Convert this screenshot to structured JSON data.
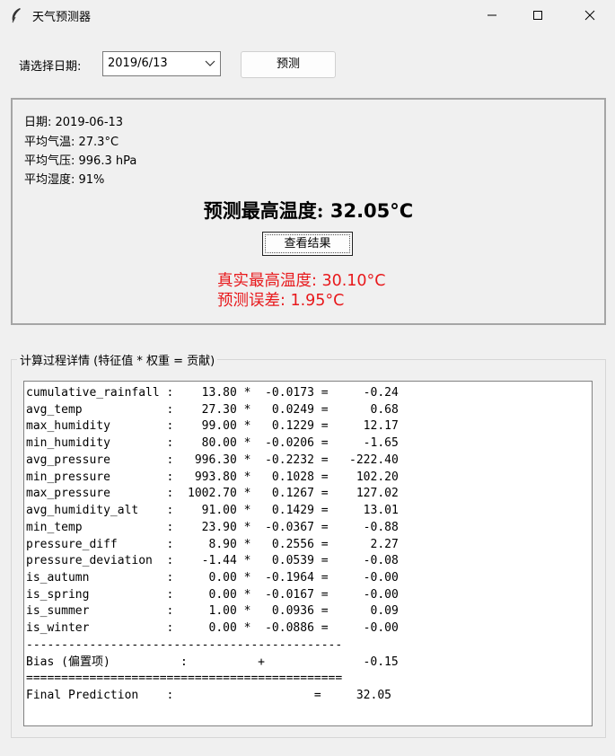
{
  "window": {
    "title": "天气预测器",
    "icon": "feather-icon",
    "controls": [
      "minimize-icon",
      "maximize-icon",
      "close-icon"
    ]
  },
  "toolbar": {
    "date_label": "请选择日期:",
    "date_value": "2019/6/13",
    "predict_label": "预测"
  },
  "info": {
    "date_line": "日期: 2019-06-13",
    "avg_temp_line": "平均气温: 27.3°C",
    "avg_pressure_line": "平均气压: 996.3 hPa",
    "avg_humidity_line": "平均湿度: 91%",
    "prediction_label": "预测最高温度: ",
    "prediction_value": "32.05°C",
    "view_result_label": "查看结果",
    "actual_max_line": "真实最高温度: 30.10°C",
    "error_line": "预测误差: 1.95°C",
    "highlight_color": "#e8191c"
  },
  "details": {
    "legend": "计算过程详情 (特征值 * 权重 = 贡献)",
    "lines": [
      "cumulative_rainfall :    13.80 *  -0.0173 =     -0.24",
      "avg_temp            :    27.30 *   0.0249 =      0.68",
      "max_humidity        :    99.00 *   0.1229 =     12.17",
      "min_humidity        :    80.00 *  -0.0206 =     -1.65",
      "avg_pressure        :   996.30 *  -0.2232 =   -222.40",
      "min_pressure        :   993.80 *   0.1028 =    102.20",
      "max_pressure        :  1002.70 *   0.1267 =    127.02",
      "avg_humidity_alt    :    91.00 *   0.1429 =     13.01",
      "min_temp            :    23.90 *  -0.0367 =     -0.88",
      "pressure_diff       :     8.90 *   0.2556 =      2.27",
      "pressure_deviation  :    -1.44 *   0.0539 =     -0.08",
      "is_autumn           :     0.00 *  -0.1964 =     -0.00",
      "is_spring           :     0.00 *  -0.0167 =     -0.00",
      "is_summer           :     1.00 *   0.0936 =      0.09",
      "is_winter           :     0.00 *  -0.0886 =     -0.00",
      "---------------------------------------------",
      "Bias (偏置项)          :          +              -0.15",
      "=============================================",
      "Final Prediction    :                    =     32.05"
    ]
  }
}
